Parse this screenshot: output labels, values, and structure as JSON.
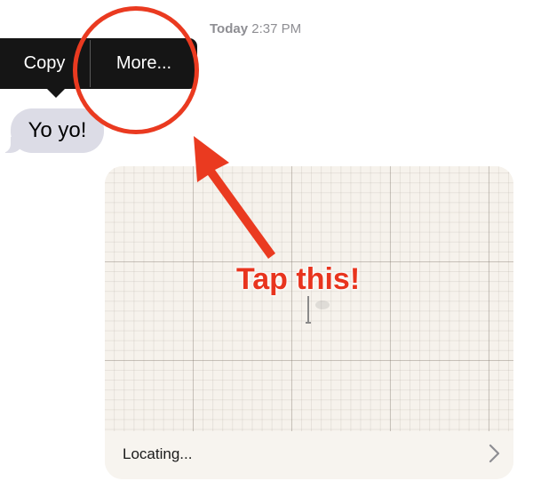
{
  "header": {
    "timestamp_day": "Today",
    "timestamp_time": "2:37 PM"
  },
  "context_menu": {
    "copy_label": "Copy",
    "more_label": "More..."
  },
  "messages": [
    {
      "direction": "incoming",
      "text": "Yo yo!"
    }
  ],
  "location_card": {
    "status": "Locating...",
    "chevron_icon": "chevron-right-icon",
    "pin_icon": "map-pin-icon"
  },
  "annotation": {
    "callout_text": "Tap this!",
    "color": "#e8341e"
  },
  "colors": {
    "menu_bg": "#151515",
    "incoming_bubble": "#dcdce6",
    "map_bg": "#f6f2ec",
    "timestamp": "#8e8e93"
  }
}
